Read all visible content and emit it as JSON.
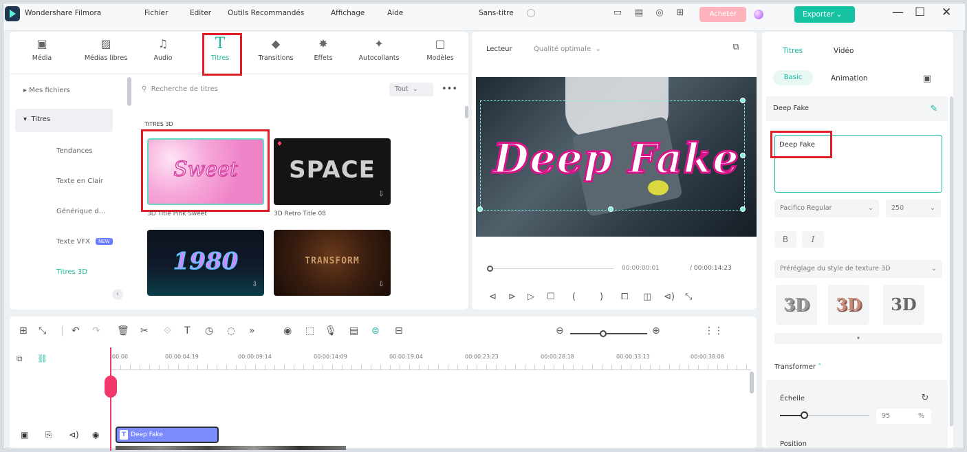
{
  "app": {
    "name": "Wondershare Filmora",
    "project": "Sans-titre"
  },
  "menu": [
    "Fichier",
    "Editer",
    "Outils Recommandés",
    "Affichage",
    "Aide"
  ],
  "toolbar": {
    "buy_label": "Acheter",
    "export_label": "Exporter"
  },
  "media_tabs": [
    {
      "label": "Média",
      "icon": "media-icon"
    },
    {
      "label": "Médias libres",
      "icon": "stock-media-icon"
    },
    {
      "label": "Audio",
      "icon": "audio-icon"
    },
    {
      "label": "Titres",
      "icon": "title-icon"
    },
    {
      "label": "Transitions",
      "icon": "transition-icon"
    },
    {
      "label": "Effets",
      "icon": "effects-icon"
    },
    {
      "label": "Autocollants",
      "icon": "sticker-icon"
    },
    {
      "label": "Modèles",
      "icon": "template-icon"
    }
  ],
  "left_nav": {
    "my_files": "Mes fichiers",
    "titles": "Titres",
    "items": [
      "Tendances",
      "Texte en Clair",
      "Générique d...",
      "Texte VFX",
      "Titres 3D"
    ],
    "new_badge": "NEW"
  },
  "search": {
    "placeholder": "Recherche de titres",
    "filter": "Tout"
  },
  "section_title": "TITRES 3D",
  "thumbnails": [
    {
      "text": "Sweet",
      "label": "3D Title Pink Sweet"
    },
    {
      "text": "SPACE",
      "label": "3D Retro Title 08"
    },
    {
      "text": "1980",
      "label": ""
    },
    {
      "text": "TRANSFORM",
      "label": ""
    }
  ],
  "player": {
    "tab": "Lecteur",
    "quality": "Qualité optimale",
    "overlay_text": "Deep Fake",
    "current_time": "00:00:00:01",
    "total_time": "/ 00:00:14:23"
  },
  "inspector": {
    "tabs": [
      "Titres",
      "Vidéo"
    ],
    "subtabs": [
      "Basic",
      "Animation"
    ],
    "section": "Deep Fake",
    "text_value": "Deep Fake",
    "font": "Pacifico Regular",
    "font_size": "250",
    "bold": "B",
    "italic": "I",
    "preset_label": "Préréglage du style de texture 3D",
    "transform_label": "Transformer",
    "scale_label": "Échelle",
    "scale_value": "95",
    "scale_unit": "%",
    "position_label": "Position"
  },
  "timeline": {
    "timecodes": [
      "00:00",
      "00:00:04:19",
      "00:00:09:14",
      "00:00:14:09",
      "00:00:19:04",
      "00:00:23:23",
      "00:00:28:18",
      "00:00:33:13",
      "00:00:38:08"
    ],
    "clip_label": "Deep Fake"
  },
  "colors": {
    "accent": "#1bb8a0",
    "highlight": "#e11d25",
    "playhead": "#f2386a"
  }
}
